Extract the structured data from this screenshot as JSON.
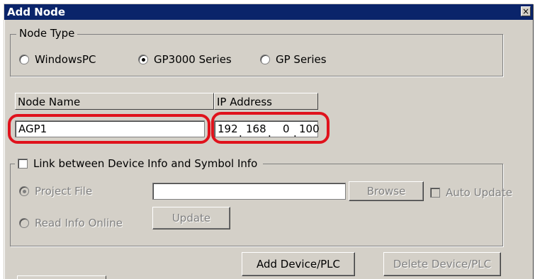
{
  "dialog": {
    "title": "Add Node",
    "close_glyph": "×"
  },
  "node_type": {
    "group_label": "Node Type",
    "options": [
      {
        "label": "WindowsPC",
        "selected": false
      },
      {
        "label": "GP3000 Series",
        "selected": true
      },
      {
        "label": "GP Series",
        "selected": false
      }
    ]
  },
  "node_name": {
    "header": "Node Name",
    "value": "AGP1"
  },
  "ip_address": {
    "header": "IP Address",
    "octets": [
      "192",
      "168",
      "0",
      "100"
    ],
    "separator": "."
  },
  "link": {
    "checkbox_label": "Link between Device Info and Symbol Info",
    "checked": false,
    "project_file_label": "Project File",
    "project_file_value": "",
    "browse_label": "Browse",
    "auto_update_label": "Auto Update",
    "read_online_label": "Read Info Online",
    "update_label": "Update"
  },
  "footer": {
    "add_device_label": "Add Device/PLC",
    "delete_device_label": "Delete Device/PLC"
  },
  "annotation_color": "#e0121c",
  "icons": [
    "close-icon"
  ]
}
